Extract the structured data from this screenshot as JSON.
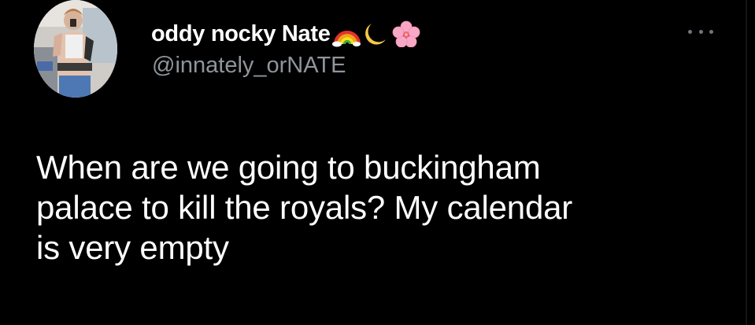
{
  "tweet": {
    "author": {
      "display_name": "oddy nocky Nate",
      "handle": "@innately_orNATE",
      "name_emojis": [
        "rainbow-emoji",
        "crescent-moon-emoji",
        "cherry-blossom-emoji"
      ],
      "avatar_icon": "profile-photo"
    },
    "more_icon": "more-options-icon",
    "text_lines": [
      "When are we going to buckingham",
      "palace to kill the royals? My calendar",
      "is very empty"
    ]
  },
  "colors": {
    "background": "#000000",
    "text_primary": "#ffffff",
    "text_secondary": "#8f959b",
    "more_icon": "#6e767d"
  }
}
